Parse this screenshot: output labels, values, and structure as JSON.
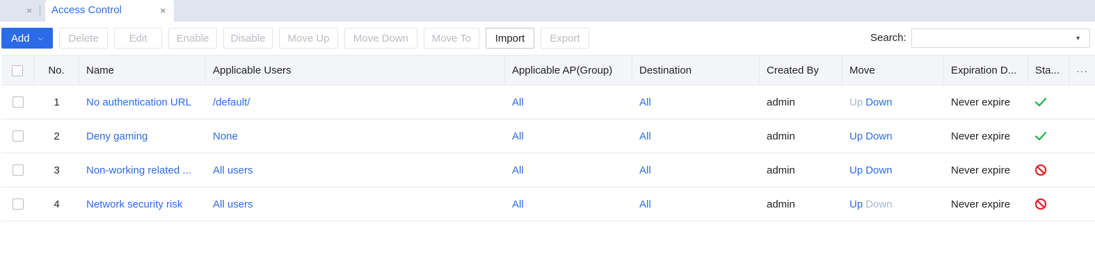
{
  "tabs": {
    "previous_close": "×",
    "active_label": "Access Control",
    "active_close": "×"
  },
  "toolbar": {
    "add_label": "Add",
    "delete_label": "Delete",
    "edit_label": "Edit",
    "enable_label": "Enable",
    "disable_label": "Disable",
    "move_up_label": "Move Up",
    "move_down_label": "Move Down",
    "move_to_label": "Move To",
    "import_label": "Import",
    "export_label": "Export",
    "search_label": "Search:",
    "search_value": ""
  },
  "table": {
    "headers": {
      "no": "No.",
      "name": "Name",
      "users": "Applicable Users",
      "ap": "Applicable AP(Group)",
      "destination": "Destination",
      "created_by": "Created By",
      "move": "Move",
      "expiration": "Expiration D...",
      "status": "Sta...",
      "more": "···"
    },
    "rows": [
      {
        "no": "1",
        "name": "No authentication URL",
        "users": "/default/",
        "ap": "All",
        "destination": "All",
        "created_by": "admin",
        "move_up": "Up",
        "move_down": "Down",
        "up_enabled": false,
        "down_enabled": true,
        "expiration": "Never expire",
        "status": "enabled"
      },
      {
        "no": "2",
        "name": "Deny gaming",
        "users": "None",
        "ap": "All",
        "destination": "All",
        "created_by": "admin",
        "move_up": "Up",
        "move_down": "Down",
        "up_enabled": true,
        "down_enabled": true,
        "expiration": "Never expire",
        "status": "enabled"
      },
      {
        "no": "3",
        "name": "Non-working related ...",
        "users": "All users",
        "ap": "All",
        "destination": "All",
        "created_by": "admin",
        "move_up": "Up",
        "move_down": "Down",
        "up_enabled": true,
        "down_enabled": true,
        "expiration": "Never expire",
        "status": "disabled"
      },
      {
        "no": "4",
        "name": "Network security risk",
        "users": "All users",
        "ap": "All",
        "destination": "All",
        "created_by": "admin",
        "move_up": "Up",
        "move_down": "Down",
        "up_enabled": true,
        "down_enabled": false,
        "expiration": "Never expire",
        "status": "disabled"
      }
    ]
  },
  "colors": {
    "accent": "#2b6be6",
    "status_enabled": "#22b04a",
    "status_disabled": "#e0202a"
  },
  "icons": {
    "tab_close": "close-icon",
    "add_caret": "chevron-down-icon",
    "search_caret": "caret-down-icon",
    "status_enabled": "check-icon",
    "status_disabled": "ban-icon",
    "column_menu": "more-icon"
  }
}
